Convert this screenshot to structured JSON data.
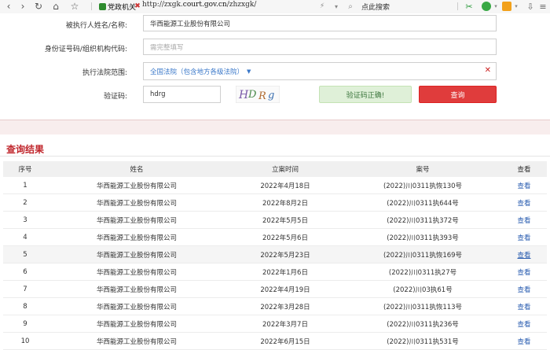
{
  "browser": {
    "gov_label": "党政机关",
    "url_prefix": "http://zxgk.",
    "url_domain": "court.gov.cn",
    "url_suffix": "/zhzxgk/",
    "search_hint": "点此搜索"
  },
  "form": {
    "name_label": "被执行人姓名/名称:",
    "name_value": "华西能源工业股份有限公司",
    "id_label": "身份证号码/组织机构代码:",
    "id_placeholder": "需完整填写",
    "court_label": "执行法院范围:",
    "court_value": "全国法院（包含地方各级法院）",
    "captcha_label": "验证码:",
    "captcha_value": "hdrg",
    "captcha_image_text": "HDRg",
    "verify_status": "验证码正确!",
    "query_button": "查询"
  },
  "results": {
    "title": "查询结果",
    "columns": [
      "序号",
      "姓名",
      "立案时间",
      "案号",
      "查看"
    ],
    "rows": [
      {
        "no": "1",
        "name": "华西能源工业股份有限公司",
        "date": "2022年4月18日",
        "case": "(2022)川0311执恢130号",
        "view": "查看"
      },
      {
        "no": "2",
        "name": "华西能源工业股份有限公司",
        "date": "2022年8月2日",
        "case": "(2022)川0311执644号",
        "view": "查看"
      },
      {
        "no": "3",
        "name": "华西能源工业股份有限公司",
        "date": "2022年5月5日",
        "case": "(2022)川0311执372号",
        "view": "查看"
      },
      {
        "no": "4",
        "name": "华西能源工业股份有限公司",
        "date": "2022年5月6日",
        "case": "(2022)川0311执393号",
        "view": "查看"
      },
      {
        "no": "5",
        "name": "华西能源工业股份有限公司",
        "date": "2022年5月23日",
        "case": "(2022)川0311执恢169号",
        "view": "查看"
      },
      {
        "no": "6",
        "name": "华西能源工业股份有限公司",
        "date": "2022年1月6日",
        "case": "(2022)川0311执27号",
        "view": "查看"
      },
      {
        "no": "7",
        "name": "华西能源工业股份有限公司",
        "date": "2022年4月19日",
        "case": "(2022)川03执61号",
        "view": "查看"
      },
      {
        "no": "8",
        "name": "华西能源工业股份有限公司",
        "date": "2022年3月28日",
        "case": "(2022)川0311执恢113号",
        "view": "查看"
      },
      {
        "no": "9",
        "name": "华西能源工业股份有限公司",
        "date": "2022年3月7日",
        "case": "(2022)川0311执236号",
        "view": "查看"
      },
      {
        "no": "10",
        "name": "华西能源工业股份有限公司",
        "date": "2022年6月15日",
        "case": "(2022)川0311执531号",
        "view": "查看"
      }
    ]
  }
}
